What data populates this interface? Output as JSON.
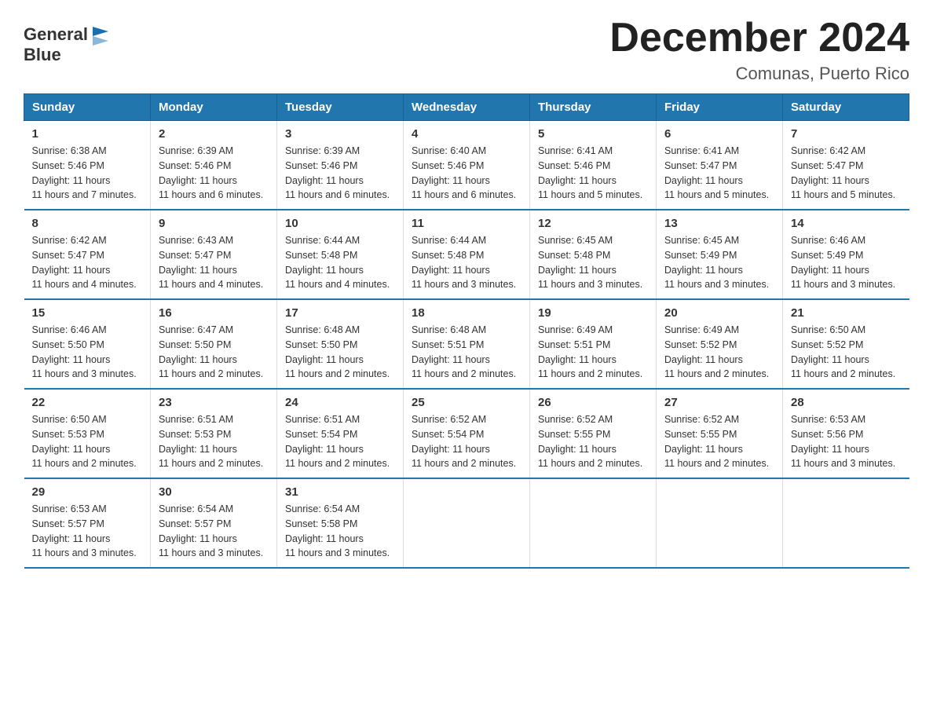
{
  "logo": {
    "text_general": "General",
    "text_blue": "Blue",
    "alt": "GeneralBlue logo"
  },
  "title": "December 2024",
  "subtitle": "Comunas, Puerto Rico",
  "days_of_week": [
    "Sunday",
    "Monday",
    "Tuesday",
    "Wednesday",
    "Thursday",
    "Friday",
    "Saturday"
  ],
  "weeks": [
    [
      {
        "day": "1",
        "sunrise": "6:38 AM",
        "sunset": "5:46 PM",
        "daylight": "11 hours and 7 minutes."
      },
      {
        "day": "2",
        "sunrise": "6:39 AM",
        "sunset": "5:46 PM",
        "daylight": "11 hours and 6 minutes."
      },
      {
        "day": "3",
        "sunrise": "6:39 AM",
        "sunset": "5:46 PM",
        "daylight": "11 hours and 6 minutes."
      },
      {
        "day": "4",
        "sunrise": "6:40 AM",
        "sunset": "5:46 PM",
        "daylight": "11 hours and 6 minutes."
      },
      {
        "day": "5",
        "sunrise": "6:41 AM",
        "sunset": "5:46 PM",
        "daylight": "11 hours and 5 minutes."
      },
      {
        "day": "6",
        "sunrise": "6:41 AM",
        "sunset": "5:47 PM",
        "daylight": "11 hours and 5 minutes."
      },
      {
        "day": "7",
        "sunrise": "6:42 AM",
        "sunset": "5:47 PM",
        "daylight": "11 hours and 5 minutes."
      }
    ],
    [
      {
        "day": "8",
        "sunrise": "6:42 AM",
        "sunset": "5:47 PM",
        "daylight": "11 hours and 4 minutes."
      },
      {
        "day": "9",
        "sunrise": "6:43 AM",
        "sunset": "5:47 PM",
        "daylight": "11 hours and 4 minutes."
      },
      {
        "day": "10",
        "sunrise": "6:44 AM",
        "sunset": "5:48 PM",
        "daylight": "11 hours and 4 minutes."
      },
      {
        "day": "11",
        "sunrise": "6:44 AM",
        "sunset": "5:48 PM",
        "daylight": "11 hours and 3 minutes."
      },
      {
        "day": "12",
        "sunrise": "6:45 AM",
        "sunset": "5:48 PM",
        "daylight": "11 hours and 3 minutes."
      },
      {
        "day": "13",
        "sunrise": "6:45 AM",
        "sunset": "5:49 PM",
        "daylight": "11 hours and 3 minutes."
      },
      {
        "day": "14",
        "sunrise": "6:46 AM",
        "sunset": "5:49 PM",
        "daylight": "11 hours and 3 minutes."
      }
    ],
    [
      {
        "day": "15",
        "sunrise": "6:46 AM",
        "sunset": "5:50 PM",
        "daylight": "11 hours and 3 minutes."
      },
      {
        "day": "16",
        "sunrise": "6:47 AM",
        "sunset": "5:50 PM",
        "daylight": "11 hours and 2 minutes."
      },
      {
        "day": "17",
        "sunrise": "6:48 AM",
        "sunset": "5:50 PM",
        "daylight": "11 hours and 2 minutes."
      },
      {
        "day": "18",
        "sunrise": "6:48 AM",
        "sunset": "5:51 PM",
        "daylight": "11 hours and 2 minutes."
      },
      {
        "day": "19",
        "sunrise": "6:49 AM",
        "sunset": "5:51 PM",
        "daylight": "11 hours and 2 minutes."
      },
      {
        "day": "20",
        "sunrise": "6:49 AM",
        "sunset": "5:52 PM",
        "daylight": "11 hours and 2 minutes."
      },
      {
        "day": "21",
        "sunrise": "6:50 AM",
        "sunset": "5:52 PM",
        "daylight": "11 hours and 2 minutes."
      }
    ],
    [
      {
        "day": "22",
        "sunrise": "6:50 AM",
        "sunset": "5:53 PM",
        "daylight": "11 hours and 2 minutes."
      },
      {
        "day": "23",
        "sunrise": "6:51 AM",
        "sunset": "5:53 PM",
        "daylight": "11 hours and 2 minutes."
      },
      {
        "day": "24",
        "sunrise": "6:51 AM",
        "sunset": "5:54 PM",
        "daylight": "11 hours and 2 minutes."
      },
      {
        "day": "25",
        "sunrise": "6:52 AM",
        "sunset": "5:54 PM",
        "daylight": "11 hours and 2 minutes."
      },
      {
        "day": "26",
        "sunrise": "6:52 AM",
        "sunset": "5:55 PM",
        "daylight": "11 hours and 2 minutes."
      },
      {
        "day": "27",
        "sunrise": "6:52 AM",
        "sunset": "5:55 PM",
        "daylight": "11 hours and 2 minutes."
      },
      {
        "day": "28",
        "sunrise": "6:53 AM",
        "sunset": "5:56 PM",
        "daylight": "11 hours and 3 minutes."
      }
    ],
    [
      {
        "day": "29",
        "sunrise": "6:53 AM",
        "sunset": "5:57 PM",
        "daylight": "11 hours and 3 minutes."
      },
      {
        "day": "30",
        "sunrise": "6:54 AM",
        "sunset": "5:57 PM",
        "daylight": "11 hours and 3 minutes."
      },
      {
        "day": "31",
        "sunrise": "6:54 AM",
        "sunset": "5:58 PM",
        "daylight": "11 hours and 3 minutes."
      },
      null,
      null,
      null,
      null
    ]
  ]
}
